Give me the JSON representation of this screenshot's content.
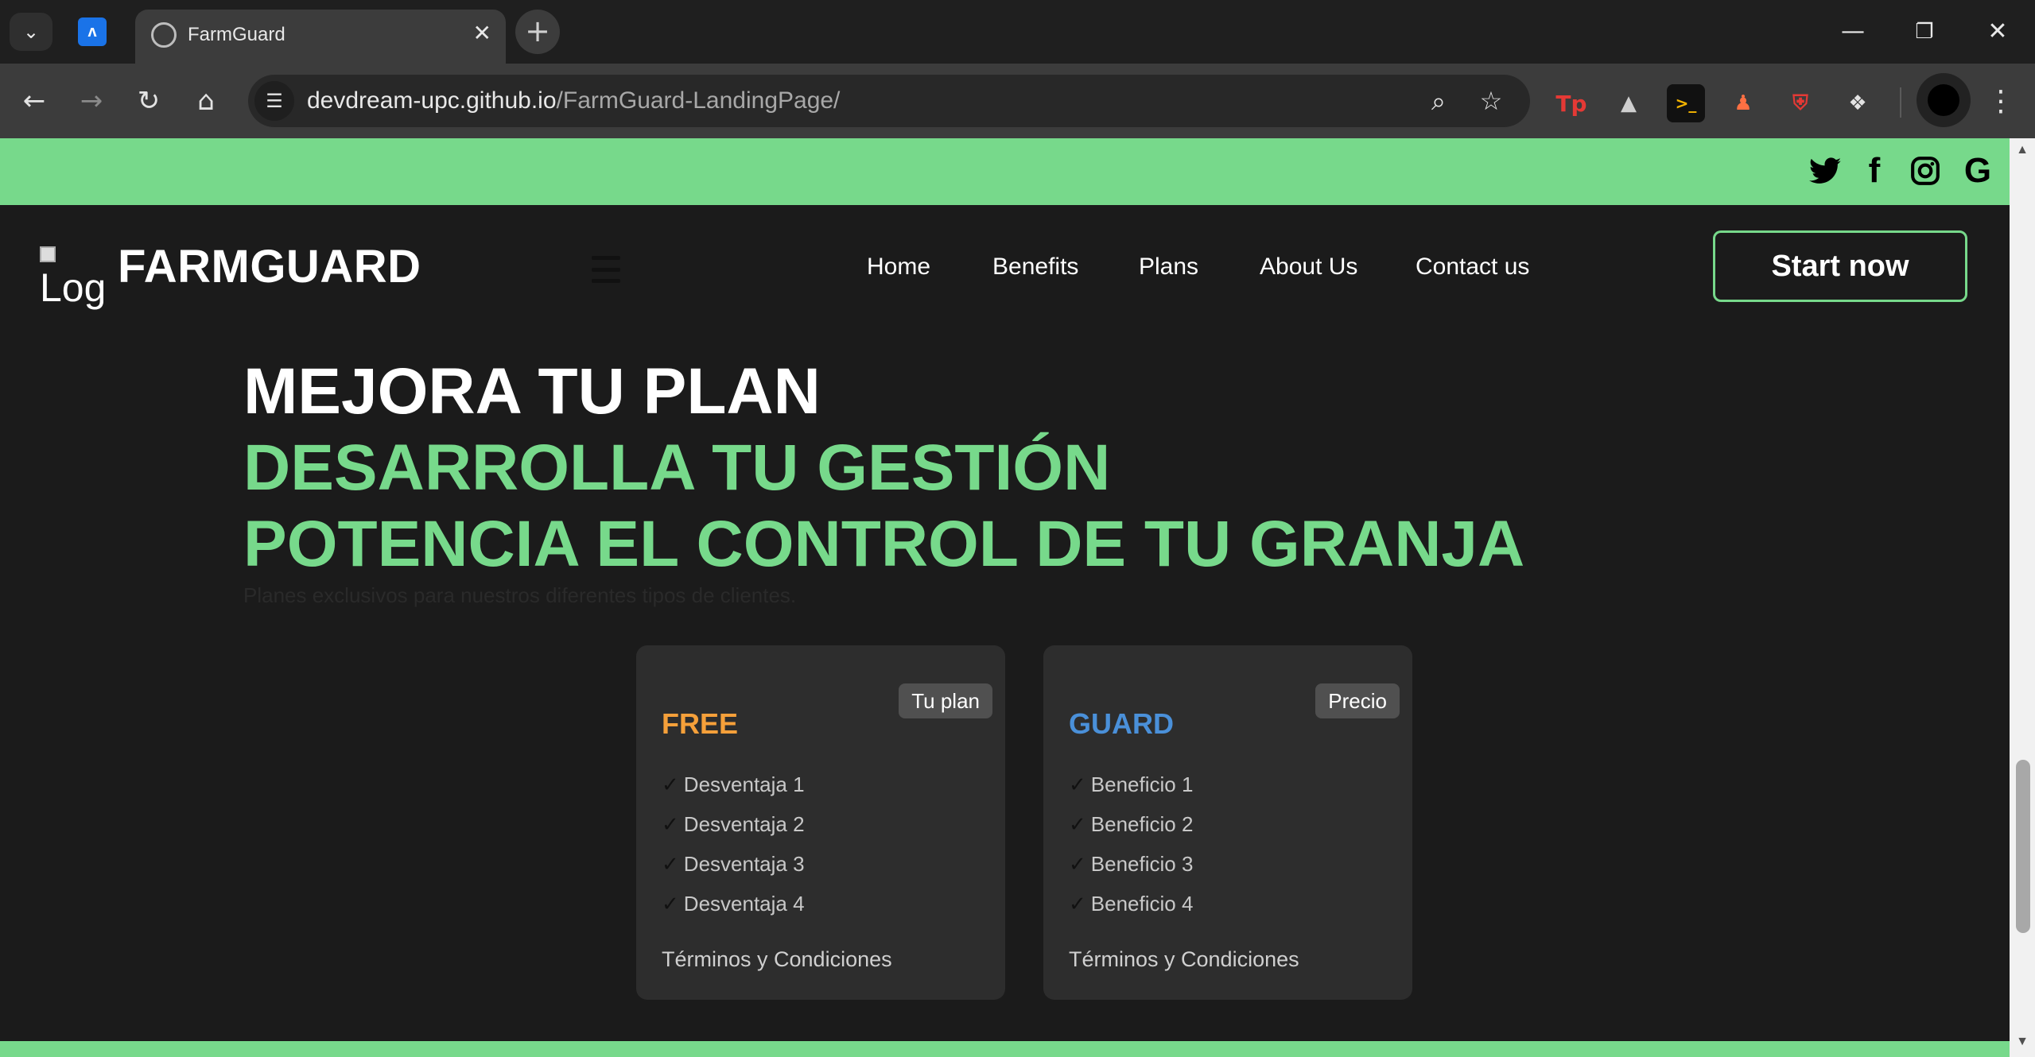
{
  "browser": {
    "tab_title": "FarmGuard",
    "tab_list_icon": "chevron-down-icon",
    "pinned_tab_letter": "ʌ",
    "new_tab_glyph": "+",
    "close_glyph": "✕",
    "url_host": "devdream-upc.github.io",
    "url_path": "/FarmGuard-LandingPage/",
    "win_minimize": "—",
    "win_restore": "❐",
    "win_close": "✕",
    "ext_tp": "Tp",
    "ext_term": ">_"
  },
  "social": {
    "icons": [
      "twitter-icon",
      "facebook-icon",
      "instagram-icon",
      "google-icon"
    ],
    "facebook_glyph": "f",
    "google_glyph": "G"
  },
  "header": {
    "logo_alt": "Log",
    "brand": "FARMGUARD",
    "nav": [
      "Home",
      "Benefits",
      "Plans",
      "About Us",
      "Contact us"
    ],
    "cta": "Start now"
  },
  "hero": {
    "line1": "MEJORA TU PLAN",
    "line2": "DESARROLLA TU GESTIÓN",
    "line3": "POTENCIA EL CONTROL DE TU GRANJA",
    "subtitle": "Planes exclusivos para nuestros diferentes tipos de clientes."
  },
  "plans": [
    {
      "badge": "Tu plan",
      "name": "FREE",
      "name_color": "#f5a03a",
      "features": [
        "Desventaja 1",
        "Desventaja 2",
        "Desventaja 3",
        "Desventaja 4"
      ],
      "terms": "Términos y Condiciones"
    },
    {
      "badge": "Precio",
      "name": "GUARD",
      "name_color": "#4a90d9",
      "features": [
        "Beneficio 1",
        "Beneficio 2",
        "Beneficio 3",
        "Beneficio 4"
      ],
      "terms": "Términos y Condiciones"
    }
  ],
  "colors": {
    "accent_green": "#77d98b",
    "page_bg": "#1b1b1b",
    "card_bg": "#2d2d2d"
  }
}
